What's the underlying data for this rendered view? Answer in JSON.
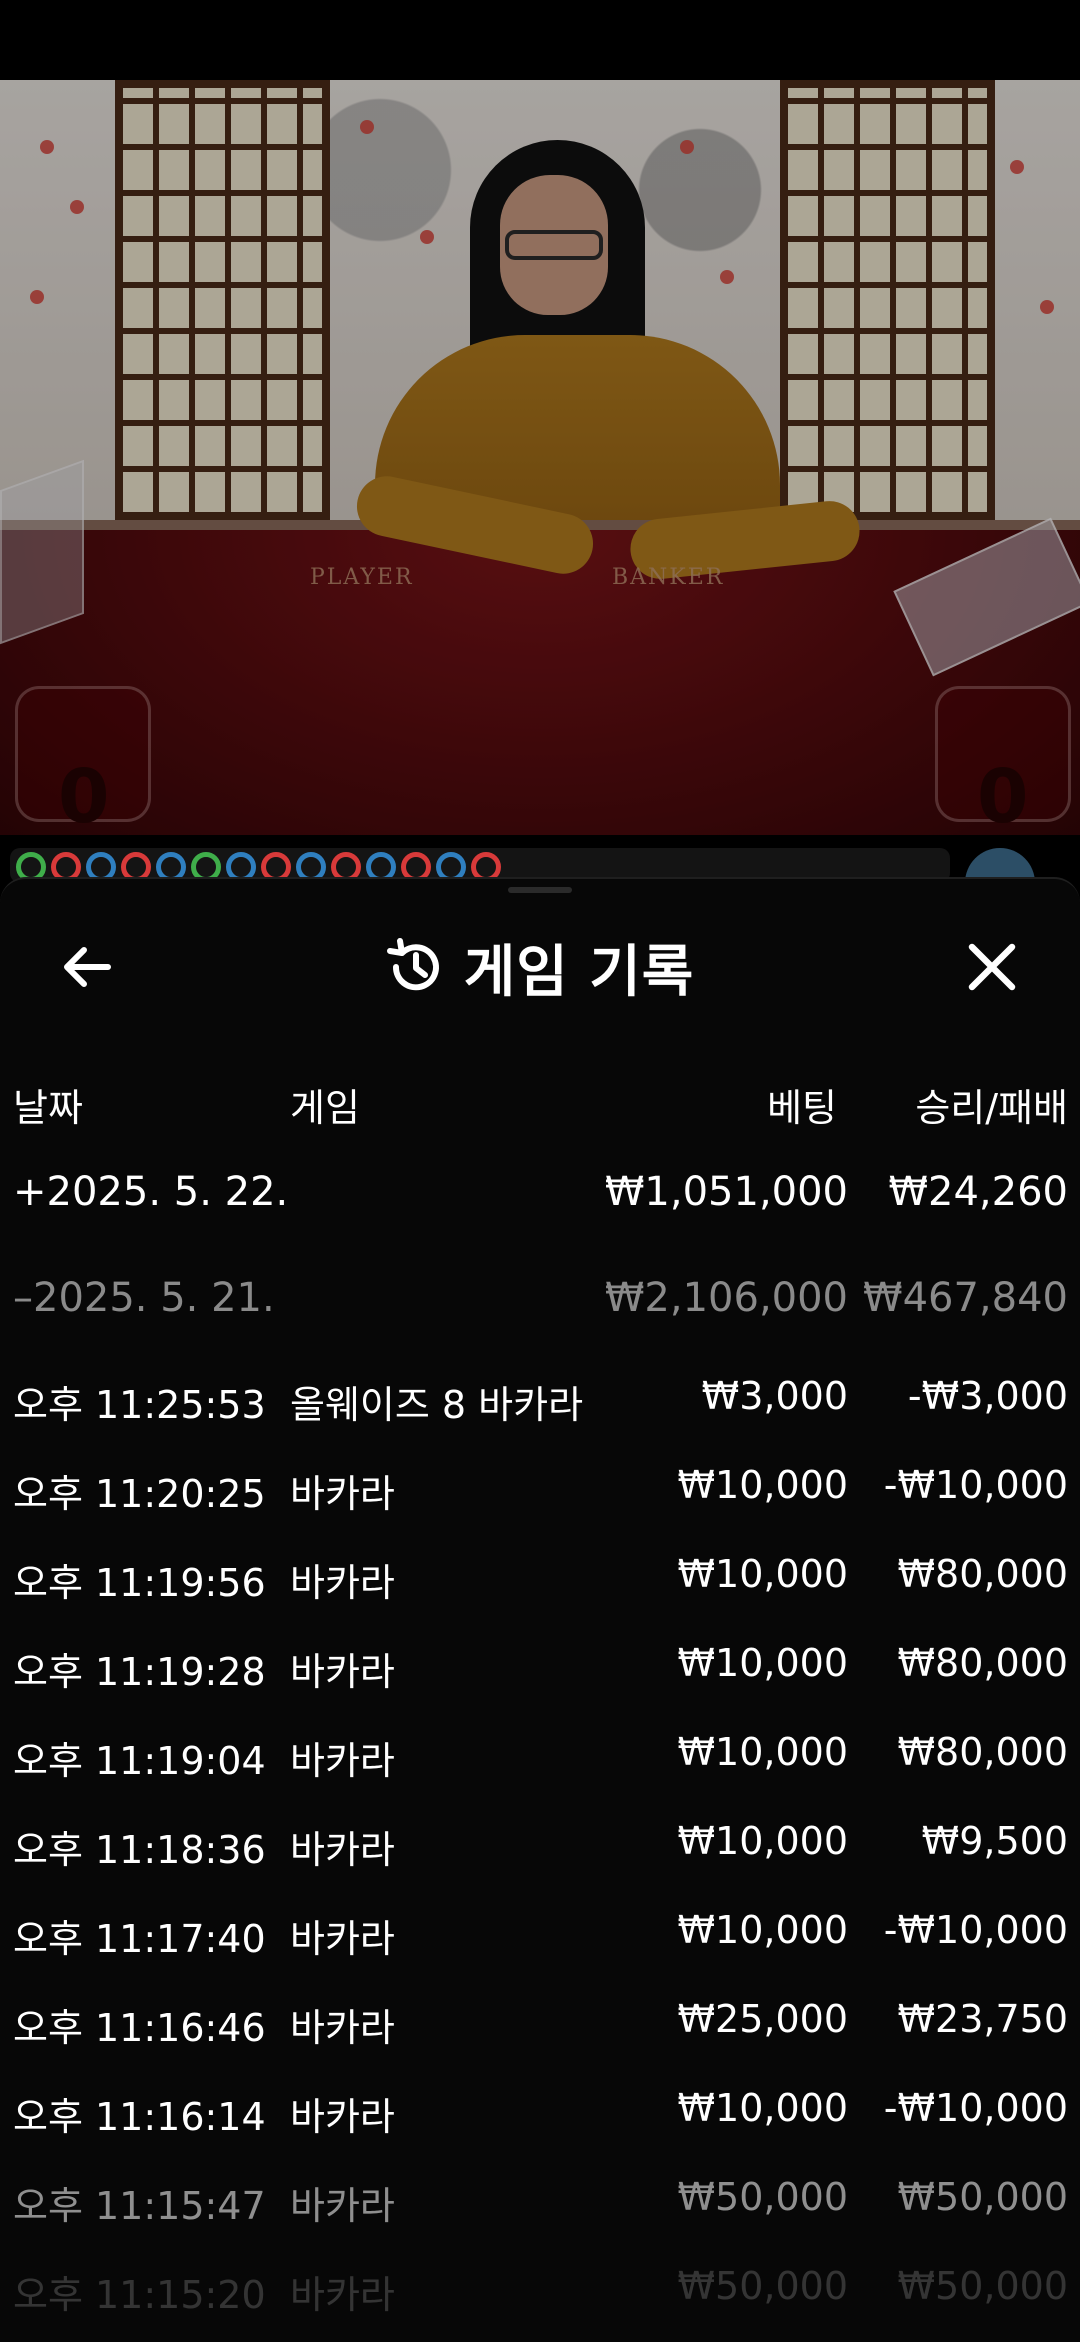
{
  "header": {
    "title": "게임 기록",
    "icons": {
      "back": "arrow-left-icon",
      "history": "history-icon",
      "close": "close-icon"
    }
  },
  "table_labels": {
    "player": "PLAYER",
    "banker": "BANKER"
  },
  "scores": {
    "player": "0",
    "banker": "0"
  },
  "columns": {
    "date": "날짜",
    "game": "게임",
    "bet": "베팅",
    "result": "승리/패배"
  },
  "days": [
    {
      "toggle": "+",
      "date": "2025. 5. 22.",
      "bet": "₩1,051,000",
      "result": "₩24,260"
    },
    {
      "toggle": "–",
      "date": "2025. 5. 21.",
      "bet": "₩2,106,000",
      "result": "₩467,840"
    }
  ],
  "rows": [
    {
      "time": "오후 11:25:53",
      "game": "올웨이즈 8 바카라",
      "bet": "₩3,000",
      "result": "-₩3,000"
    },
    {
      "time": "오후 11:20:25",
      "game": "바카라",
      "bet": "₩10,000",
      "result": "-₩10,000"
    },
    {
      "time": "오후 11:19:56",
      "game": "바카라",
      "bet": "₩10,000",
      "result": "₩80,000"
    },
    {
      "time": "오후 11:19:28",
      "game": "바카라",
      "bet": "₩10,000",
      "result": "₩80,000"
    },
    {
      "time": "오후 11:19:04",
      "game": "바카라",
      "bet": "₩10,000",
      "result": "₩80,000"
    },
    {
      "time": "오후 11:18:36",
      "game": "바카라",
      "bet": "₩10,000",
      "result": "₩9,500"
    },
    {
      "time": "오후 11:17:40",
      "game": "바카라",
      "bet": "₩10,000",
      "result": "-₩10,000"
    },
    {
      "time": "오후 11:16:46",
      "game": "바카라",
      "bet": "₩25,000",
      "result": "₩23,750"
    },
    {
      "time": "오후 11:16:14",
      "game": "바카라",
      "bet": "₩10,000",
      "result": "-₩10,000"
    },
    {
      "time": "오후 11:15:47",
      "game": "바카라",
      "bet": "₩50,000",
      "result": "₩50,000"
    },
    {
      "time": "오후 11:15:20",
      "game": "바카라",
      "bet": "₩50,000",
      "result": "₩50,000"
    }
  ],
  "colors": {
    "panel_bg": "#070707",
    "text": "#ffffff",
    "dim_text": "#8a8a8a",
    "road_player": "#2f7fbf",
    "road_banker": "#d83a3a",
    "road_tie": "#3fae4a"
  }
}
